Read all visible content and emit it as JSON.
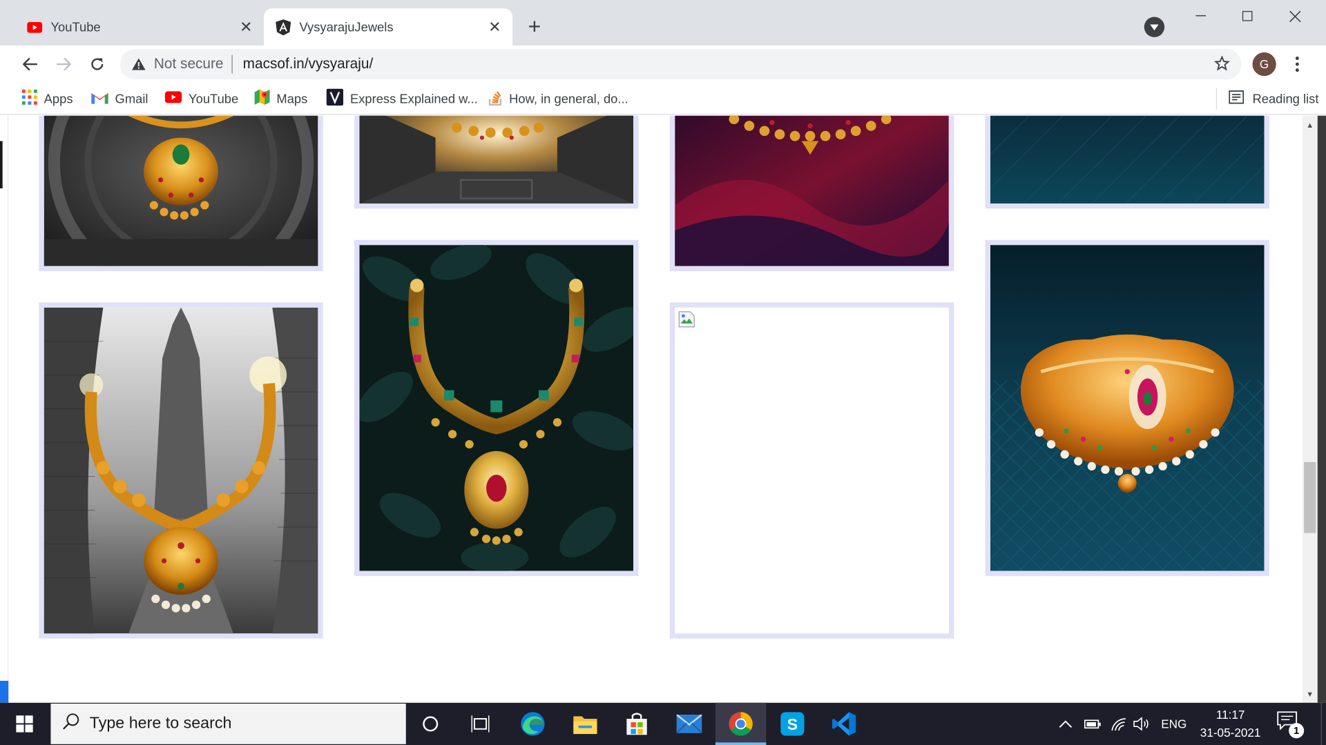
{
  "browser": {
    "tabs": [
      {
        "title": "YouTube",
        "active": false,
        "favicon": "youtube-icon"
      },
      {
        "title": "VysyarajuJewels",
        "active": true,
        "favicon": "angular-icon"
      }
    ],
    "omnibox": {
      "security_text": "Not secure",
      "url": "macsof.in/vysyaraju/"
    },
    "profile_initial": "G",
    "bookmarks": [
      {
        "label": "Apps",
        "icon": "apps-grid-icon"
      },
      {
        "label": "Gmail",
        "icon": "gmail-icon"
      },
      {
        "label": "YouTube",
        "icon": "youtube-icon"
      },
      {
        "label": "Maps",
        "icon": "maps-icon"
      },
      {
        "label": "Express Explained w...",
        "icon": "express-icon"
      },
      {
        "label": "How, in general, do...",
        "icon": "stackoverflow-icon"
      }
    ],
    "reading_list": "Reading list"
  },
  "gallery": {
    "items": [
      {
        "alt": "Gold necklace on temple wheel",
        "kind": "necklace-dark-stone"
      },
      {
        "alt": "Gold necklace in stone corridor",
        "kind": "necklace-corridor"
      },
      {
        "alt": "Gold necklace on crimson silk",
        "kind": "necklace-red"
      },
      {
        "alt": "Jewellery on teal background",
        "kind": "teal-plain"
      },
      {
        "alt": "Gold necklace with temple tower",
        "kind": "necklace-temple"
      },
      {
        "alt": "Diamond necklace on dark leaves",
        "kind": "necklace-leaves"
      },
      {
        "alt": "",
        "kind": "broken-image"
      },
      {
        "alt": "Gold choker on teal pattern",
        "kind": "choker-teal"
      }
    ]
  },
  "taskbar": {
    "search_placeholder": "Type here to search",
    "apps": [
      "cortana-icon",
      "task-view-icon",
      "edge-icon",
      "file-explorer-icon",
      "store-icon",
      "mail-icon",
      "chrome-icon",
      "skype-icon",
      "vscode-icon"
    ],
    "language": "ENG",
    "time": "11:17",
    "date": "31-05-2021",
    "notification_count": "1"
  }
}
